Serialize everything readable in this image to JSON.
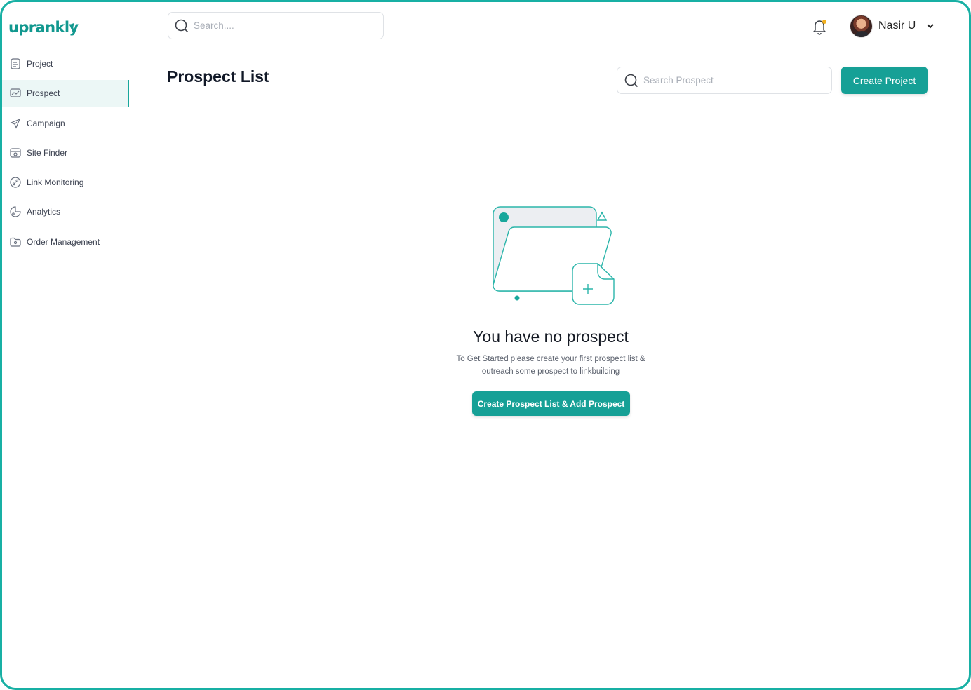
{
  "app": {
    "logo_text": "uprankly",
    "accent_color": "#16a096"
  },
  "sidebar": {
    "items": [
      {
        "label": "Project",
        "icon": "document-icon",
        "active": false
      },
      {
        "label": "Prospect",
        "icon": "chart-screen-icon",
        "active": true
      },
      {
        "label": "Campaign",
        "icon": "paper-plane-icon",
        "active": false
      },
      {
        "label": "Site Finder",
        "icon": "site-finder-icon",
        "active": false
      },
      {
        "label": "Link Monitoring",
        "icon": "link-circle-icon",
        "active": false
      },
      {
        "label": "Analytics",
        "icon": "analytics-icon",
        "active": false
      },
      {
        "label": "Order Management",
        "icon": "folder-icon",
        "active": false
      }
    ]
  },
  "topbar": {
    "search_placeholder": "Search....",
    "notification_icon": "bell-icon",
    "user_name": "Nasir U"
  },
  "main": {
    "title": "Prospect List",
    "search_placeholder": "Search Prospect",
    "create_project_label": "Create Project",
    "empty_state": {
      "title": "You have no prospect",
      "description_line1": "To Get Started please create your first prospect list &",
      "description_line2": "outreach some prospect to linkbuilding",
      "cta_label": "Create Prospect List & Add Prospect"
    }
  }
}
